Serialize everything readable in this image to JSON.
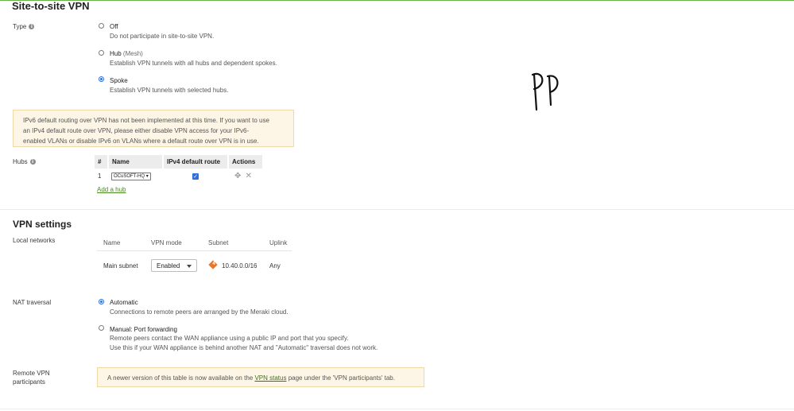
{
  "page": {
    "title": "Site-to-site VPN",
    "accent": "#67b346",
    "handwriting": "PP"
  },
  "type_section": {
    "label": "Type",
    "info_icon": "info-icon",
    "options": [
      {
        "title": "Off",
        "suffix": "",
        "desc": "Do not participate in site-to-site VPN.",
        "checked": false
      },
      {
        "title": "Hub",
        "suffix": "(Mesh)",
        "desc": "Establish VPN tunnels with all hubs and dependent spokes.",
        "checked": false
      },
      {
        "title": "Spoke",
        "suffix": "",
        "desc": "Establish VPN tunnels with selected hubs.",
        "checked": true
      }
    ]
  },
  "ipv6_warning": {
    "line1": "IPv6 default routing over VPN has not been implemented at this time. If you want to use",
    "line2": "an IPv4 default route over VPN, please either disable VPN access for your IPv6-",
    "line3": "enabled VLANs or disable IPv6 on VLANs where a default route over VPN is in use."
  },
  "hubs": {
    "label": "Hubs",
    "columns": [
      "#",
      "Name",
      "IPv4 default route",
      "Actions"
    ],
    "rows": [
      {
        "index": "1",
        "name": "OCuSOFT-HQ",
        "ipv4_default_route": true
      }
    ],
    "add_link": "Add a hub"
  },
  "vpn_settings": {
    "title": "VPN settings",
    "local_networks_label": "Local networks",
    "columns": [
      "Name",
      "VPN mode",
      "Subnet",
      "Uplink"
    ],
    "rows": [
      {
        "name": "Main subnet",
        "vpn_mode": "Enabled",
        "subnet": "10.40.0.0/16",
        "uplink": "Any",
        "subnet_badge": "4"
      }
    ]
  },
  "nat": {
    "label": "NAT traversal",
    "options": [
      {
        "title": "Automatic",
        "desc1": "Connections to remote peers are arranged by the Meraki cloud.",
        "desc2": "",
        "checked": true
      },
      {
        "title": "Manual: Port forwarding",
        "desc1": "Remote peers contact the WAN appliance using a public IP and port that you specify.",
        "desc2": "Use this if your WAN appliance is behind another NAT and \"Automatic\" traversal does not work.",
        "checked": false
      }
    ]
  },
  "remote": {
    "label_line1": "Remote VPN",
    "label_line2": "participants",
    "notice_pre": "A newer version of this table is now available on the",
    "notice_link": "VPN status",
    "notice_post": "page under the 'VPN participants' tab."
  }
}
